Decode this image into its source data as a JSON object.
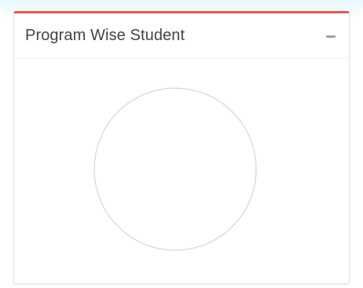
{
  "widget": {
    "title": "Program Wise Student",
    "collapse_icon": "minus-icon"
  },
  "colors": {
    "header_accent": "#e05a4c",
    "title_text": "#444444",
    "icon": "#9aa1a8",
    "chart_outline": "#d6d6d6"
  },
  "chart_data": {
    "type": "pie",
    "categories": [],
    "values": [],
    "state": "empty"
  }
}
